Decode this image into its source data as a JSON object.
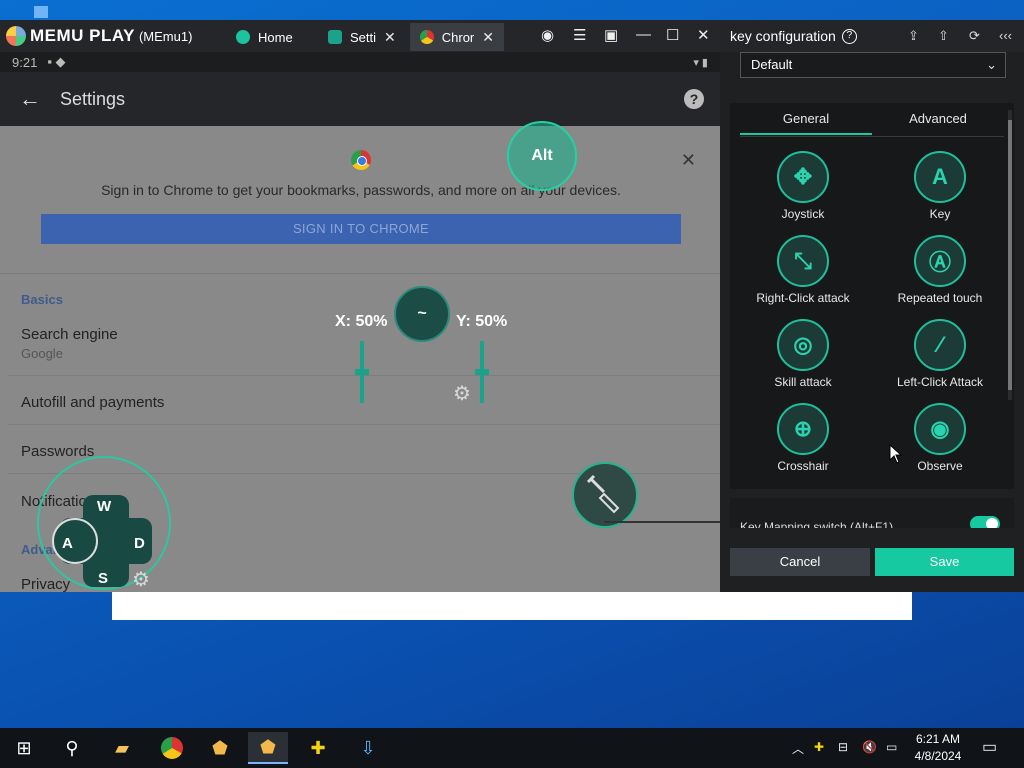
{
  "memu": {
    "logo": "MEMU PLAY",
    "instance": "(MEmu1)",
    "tabs": [
      {
        "label": "Home"
      },
      {
        "label": "Setti"
      },
      {
        "label": "Chror"
      }
    ]
  },
  "android": {
    "time": "9:21",
    "appbar_title": "Settings",
    "promo_text": "Sign in to Chrome to get your bookmarks, passwords, and more on all your devices.",
    "signin_label": "SIGN IN TO CHROME",
    "section_basics": "Basics",
    "search_engine": "Search engine",
    "search_engine_value": "Google",
    "autofill": "Autofill and payments",
    "passwords": "Passwords",
    "notifications": "Notifications",
    "advanced": "Advanced",
    "privacy": "Privacy"
  },
  "overlay": {
    "alt": "Alt",
    "x_label": "X: 50%",
    "y_label": "Y: 50%",
    "view_key": "~",
    "w": "W",
    "a": "A",
    "s": "S",
    "d": "D"
  },
  "keyconfig": {
    "title": "key configuration",
    "preset": "Default",
    "tab_general": "General",
    "tab_advanced": "Advanced",
    "tools": [
      {
        "label": "Joystick",
        "icon": "joystick-icon"
      },
      {
        "label": "Key",
        "icon": "key-icon"
      },
      {
        "label": "Right-Click attack",
        "icon": "right-click-attack-icon"
      },
      {
        "label": "Repeated touch",
        "icon": "repeated-touch-icon"
      },
      {
        "label": "Skill attack",
        "icon": "skill-attack-icon"
      },
      {
        "label": "Left-Click Attack",
        "icon": "left-click-attack-icon"
      },
      {
        "label": "Crosshair",
        "icon": "crosshair-icon"
      },
      {
        "label": "Observe",
        "icon": "observe-icon"
      }
    ],
    "key_mapping_switch": "Key Mapping switch (Alt+F1)",
    "cancel": "Cancel",
    "save": "Save"
  },
  "taskbar": {
    "time": "6:21 AM",
    "date": "4/8/2024"
  },
  "colors": {
    "accent": "#17c9a0",
    "desktop": "#0b5fc0"
  }
}
